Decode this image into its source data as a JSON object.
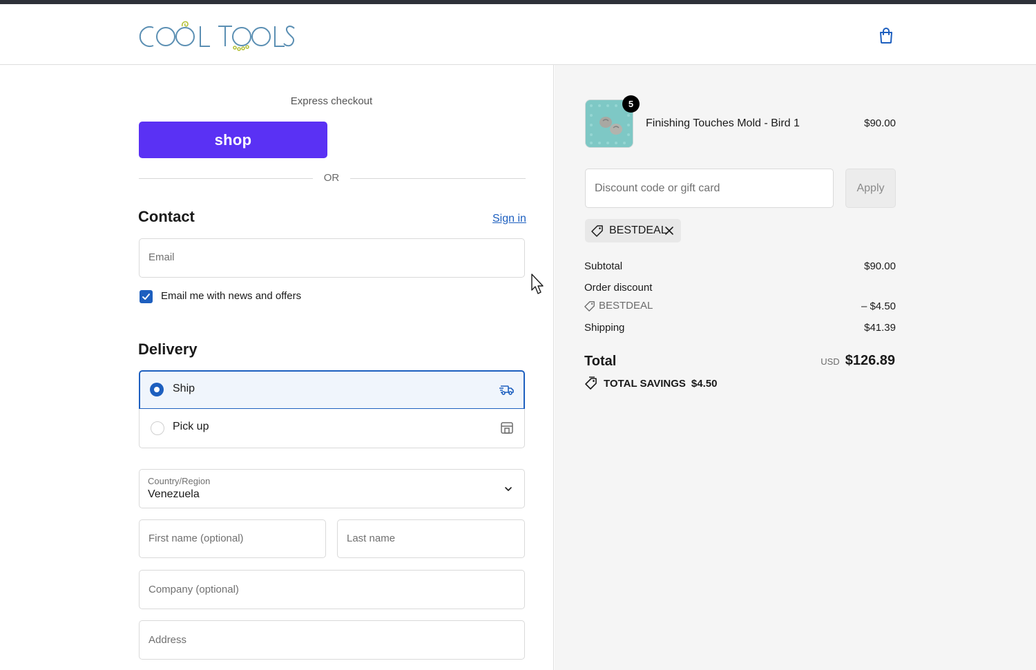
{
  "header": {
    "logo_text": "COOL TOOLS",
    "cart_icon": "shopping-bag-icon"
  },
  "express": {
    "title": "Express checkout",
    "shop_label": "shop",
    "or_label": "OR"
  },
  "contact": {
    "heading": "Contact",
    "sign_in": "Sign in",
    "email_placeholder": "Email",
    "newsletter_label": "Email me with news and offers",
    "newsletter_checked": true
  },
  "delivery": {
    "heading": "Delivery",
    "options": [
      {
        "label": "Ship",
        "selected": true,
        "icon": "truck-icon"
      },
      {
        "label": "Pick up",
        "selected": false,
        "icon": "store-icon"
      }
    ],
    "country_label": "Country/Region",
    "country_value": "Venezuela",
    "first_name_placeholder": "First name (optional)",
    "last_name_placeholder": "Last name",
    "company_placeholder": "Company (optional)",
    "address_placeholder": "Address"
  },
  "summary": {
    "item": {
      "name": "Finishing Touches Mold - Bird 1",
      "price": "$90.00",
      "quantity": "5"
    },
    "discount_placeholder": "Discount code or gift card",
    "apply_label": "Apply",
    "applied_code": "BESTDEAL",
    "subtotal_label": "Subtotal",
    "subtotal_value": "$90.00",
    "order_discount_label": "Order discount",
    "order_discount_code": "BESTDEAL",
    "order_discount_value": "– $4.50",
    "shipping_label": "Shipping",
    "shipping_value": "$41.39",
    "total_label": "Total",
    "total_currency": "USD",
    "total_value": "$126.89",
    "savings_label": "TOTAL SAVINGS",
    "savings_value": "$4.50"
  },
  "colors": {
    "accent": "#1d5fbf",
    "shop_purple": "#5a31f4",
    "logo_teal": "#5b8fb3"
  }
}
